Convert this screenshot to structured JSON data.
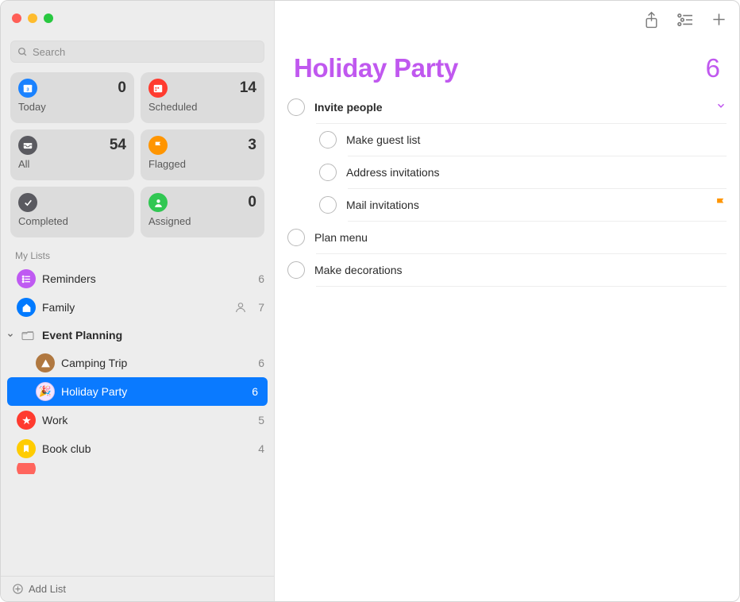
{
  "search": {
    "placeholder": "Search"
  },
  "smart": [
    {
      "label": "Today",
      "count": 0
    },
    {
      "label": "Scheduled",
      "count": 14
    },
    {
      "label": "All",
      "count": 54
    },
    {
      "label": "Flagged",
      "count": 3
    },
    {
      "label": "Completed",
      "count": ""
    },
    {
      "label": "Assigned",
      "count": 0
    }
  ],
  "section_label": "My Lists",
  "lists": {
    "reminders": {
      "name": "Reminders",
      "count": 6
    },
    "family": {
      "name": "Family",
      "count": 7
    },
    "group": {
      "name": "Event Planning"
    },
    "camping": {
      "name": "Camping Trip",
      "count": 6
    },
    "holiday": {
      "name": "Holiday Party",
      "count": 6
    },
    "work": {
      "name": "Work",
      "count": 5
    },
    "bookclub": {
      "name": "Book club",
      "count": 4
    }
  },
  "add_list_label": "Add List",
  "main": {
    "title": "Holiday Party",
    "count": 6,
    "items": {
      "invite": "Invite people",
      "guest": "Make guest list",
      "address": "Address invitations",
      "mail": "Mail invitations",
      "plan": "Plan menu",
      "deco": "Make decorations"
    }
  }
}
